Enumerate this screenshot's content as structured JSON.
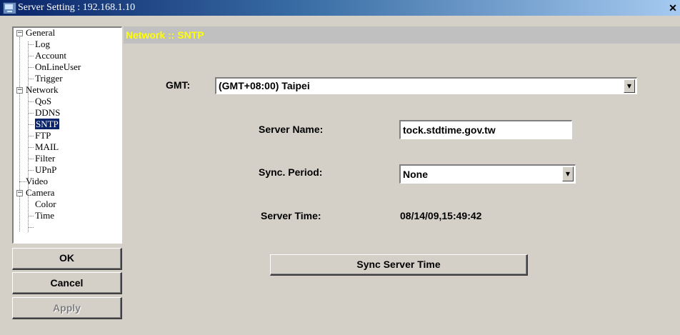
{
  "window": {
    "title": "Server Setting : 192.168.1.10",
    "close_glyph": "✕"
  },
  "tree": {
    "general": {
      "label": "General",
      "expander": "−"
    },
    "log": {
      "label": "Log"
    },
    "account": {
      "label": "Account"
    },
    "online_user": {
      "label": "OnLineUser"
    },
    "trigger": {
      "label": "Trigger"
    },
    "network": {
      "label": "Network",
      "expander": "−"
    },
    "qos": {
      "label": "QoS"
    },
    "ddns": {
      "label": "DDNS"
    },
    "sntp": {
      "label": "SNTP",
      "selected": true
    },
    "ftp": {
      "label": "FTP"
    },
    "mail": {
      "label": "MAIL"
    },
    "filter": {
      "label": "Filter"
    },
    "upnp": {
      "label": "UPnP"
    },
    "video": {
      "label": "Video"
    },
    "camera": {
      "label": "Camera",
      "expander": "−"
    },
    "color": {
      "label": "Color"
    },
    "time": {
      "label": "Time"
    }
  },
  "buttons": {
    "ok": "OK",
    "cancel": "Cancel",
    "apply": "Apply"
  },
  "panel": {
    "title": "Network :: SNTP",
    "gmt": {
      "label": "GMT:",
      "value": "(GMT+08:00) Taipei"
    },
    "server_name": {
      "label": "Server Name:",
      "value": "tock.stdtime.gov.tw"
    },
    "sync_period": {
      "label": "Sync. Period:",
      "value": "None"
    },
    "server_time": {
      "label": "Server Time:",
      "value": "08/14/09,15:49:42"
    },
    "sync_button": "Sync Server Time"
  },
  "colors": {
    "header_text": "#ffff00",
    "selection": "#0a246a",
    "face": "#d4d0c8"
  },
  "icons": {
    "dropdown": "chevron-down-icon",
    "close": "close-icon",
    "app": "server-app-icon"
  }
}
